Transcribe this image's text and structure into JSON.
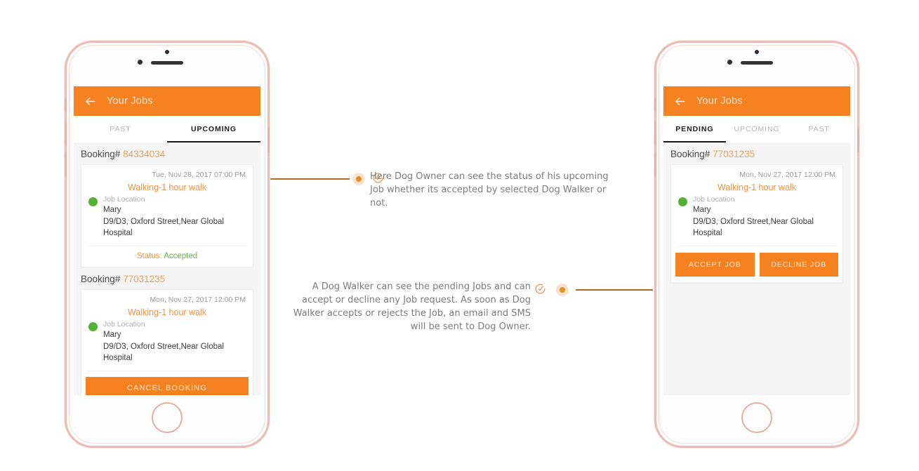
{
  "phones": [
    {
      "id": "dog-owner",
      "appbar": {
        "back_icon": "arrow-left-icon",
        "title": "Your Jobs"
      },
      "tabs": [
        {
          "label": "PAST",
          "active": false
        },
        {
          "label": "UPCOMING",
          "active": true
        }
      ],
      "bookings": [
        {
          "booking_label": "Booking#",
          "booking_number": "84334034",
          "date": "Tue, Nov 28, 2017 07:00 PM",
          "title": "Walking-1 hour walk",
          "location_label": "Job Location",
          "contact_name": "Mary",
          "address_line_1": "D9/D3, Oxford Street,Near Global",
          "address_line_2": "Hospital",
          "status_key": "Status:",
          "status_value": "Accepted",
          "action_type": "status"
        },
        {
          "booking_label": "Booking#",
          "booking_number": "77031235",
          "date": "Mon, Nov 27, 2017 12:00 PM",
          "title": "Walking-1 hour walk",
          "location_label": "Job Location",
          "contact_name": "Mary",
          "address_line_1": "D9/D3, Oxford Street,Near Global",
          "address_line_2": "Hospital",
          "primary_button": "CANCEL BOOKING",
          "action_type": "single-button"
        }
      ]
    },
    {
      "id": "dog-walker",
      "appbar": {
        "back_icon": "arrow-left-icon",
        "title": "Your Jobs"
      },
      "tabs": [
        {
          "label": "PENDING",
          "active": true
        },
        {
          "label": "UPCOMING",
          "active": false
        },
        {
          "label": "PAST",
          "active": false
        }
      ],
      "bookings": [
        {
          "booking_label": "Booking#",
          "booking_number": "77031235",
          "date": "Mon, Nov 27, 2017 12:00 PM",
          "title": "Walking-1 hour walk",
          "location_label": "Job Location",
          "contact_name": "Mary",
          "address_line_1": "D9/D3, Oxford Street,Near Global",
          "address_line_2": "Hospital",
          "accept_button": "ACCEPT JOB",
          "decline_button": "DECLINE JOB",
          "action_type": "two-buttons"
        }
      ]
    }
  ],
  "annotations": [
    {
      "id": "annotation-upcoming-status",
      "icon": "check-circle-icon",
      "marker": "bullet-marker",
      "text": "Here Dog Owner can see the status of his upcoming Job whether its accepted by selected Dog Walker or not."
    },
    {
      "id": "annotation-pending-actions",
      "icon": "check-circle-icon",
      "marker": "bullet-marker",
      "text": "A Dog Walker can see the pending Jobs and can accept or decline any Job request. As soon as Dog Walker accepts or rejects the Job, an email and SMS will be sent to Dog Owner."
    }
  ],
  "colors": {
    "brand_orange": "#f68121",
    "title_orange": "#f2924a",
    "booking_number_orange": "#f0a05a",
    "accepted_green": "#6bb34a",
    "dot_green": "#53b135",
    "connector_brown": "#b56a21",
    "marker_fill": "#fbe2cf",
    "screen_bg": "#f5f5f5",
    "bezel_rose_gold": "#e9bcb7",
    "annotation_text": "#7d7d7d"
  }
}
